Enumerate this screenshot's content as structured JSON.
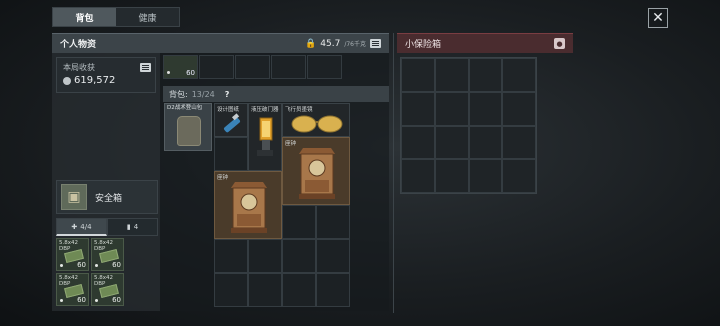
{
  "tabs": [
    {
      "label": "背包",
      "active": true
    },
    {
      "label": "健康",
      "active": false
    }
  ],
  "personal": {
    "title": "个人物资",
    "weight": "45.7",
    "weight_max": "/76千克"
  },
  "earnings": {
    "label": "本局收获",
    "value": "619,572"
  },
  "top_strip": {
    "count": "60"
  },
  "backpack": {
    "label": "背包:",
    "capacity": "13/24",
    "help": "?",
    "bag_name": "D2战术登山包"
  },
  "items": {
    "design_drawing": "设计图纸",
    "pressure_gate": "液压破门器",
    "sunglasses": "飞行员墨镜",
    "clock_a": "座钟",
    "clock_b": "座钟"
  },
  "safebox": {
    "label": "安全箱"
  },
  "ammo_tabs": [
    {
      "label": "4/4",
      "active": true,
      "icon": "medkit-icon"
    },
    {
      "label": "4",
      "active": false,
      "icon": "battery-icon"
    }
  ],
  "ammo": [
    {
      "name": "5.8x42 DBP",
      "count": "60"
    },
    {
      "name": "5.8x42 DBP",
      "count": "60"
    },
    {
      "name": "5.8x42 DBP",
      "count": "60"
    },
    {
      "name": "5.8x42 DBP",
      "count": "60"
    }
  ],
  "small_safe": {
    "title": "小保险箱"
  },
  "icons": {
    "close": "close-icon",
    "lock": "lock-icon",
    "menu": "menu-icon",
    "pin": "pin-icon",
    "coin": "coin-icon"
  }
}
